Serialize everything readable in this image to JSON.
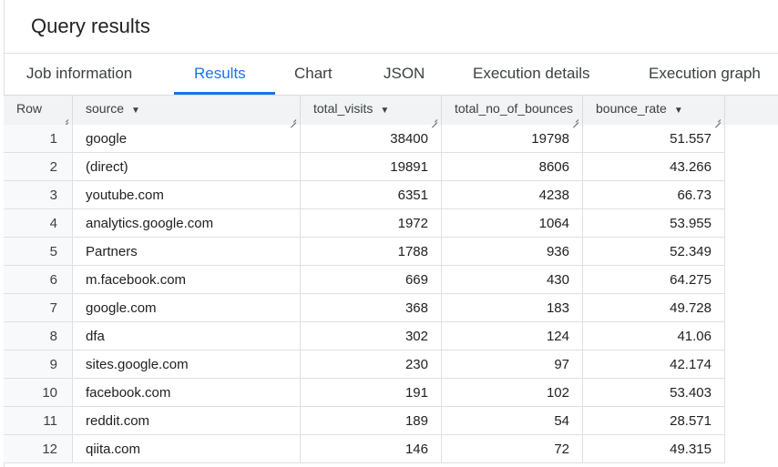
{
  "header": {
    "title": "Query results"
  },
  "tabs": [
    {
      "label": "Job information"
    },
    {
      "label": "Results"
    },
    {
      "label": "Chart"
    },
    {
      "label": "JSON"
    },
    {
      "label": "Execution details"
    },
    {
      "label": "Execution graph"
    }
  ],
  "active_tab": "Results",
  "table": {
    "columns": [
      {
        "label": "Row"
      },
      {
        "label": "source"
      },
      {
        "label": "total_visits"
      },
      {
        "label": "total_no_of_bounces"
      },
      {
        "label": "bounce_rate"
      }
    ],
    "rows": [
      {
        "row": "1",
        "source": "google",
        "total_visits": "38400",
        "total_no_of_bounces": "19798",
        "bounce_rate": "51.557"
      },
      {
        "row": "2",
        "source": "(direct)",
        "total_visits": "19891",
        "total_no_of_bounces": "8606",
        "bounce_rate": "43.266"
      },
      {
        "row": "3",
        "source": "youtube.com",
        "total_visits": "6351",
        "total_no_of_bounces": "4238",
        "bounce_rate": "66.73"
      },
      {
        "row": "4",
        "source": "analytics.google.com",
        "total_visits": "1972",
        "total_no_of_bounces": "1064",
        "bounce_rate": "53.955"
      },
      {
        "row": "5",
        "source": "Partners",
        "total_visits": "1788",
        "total_no_of_bounces": "936",
        "bounce_rate": "52.349"
      },
      {
        "row": "6",
        "source": "m.facebook.com",
        "total_visits": "669",
        "total_no_of_bounces": "430",
        "bounce_rate": "64.275"
      },
      {
        "row": "7",
        "source": "google.com",
        "total_visits": "368",
        "total_no_of_bounces": "183",
        "bounce_rate": "49.728"
      },
      {
        "row": "8",
        "source": "dfa",
        "total_visits": "302",
        "total_no_of_bounces": "124",
        "bounce_rate": "41.06"
      },
      {
        "row": "9",
        "source": "sites.google.com",
        "total_visits": "230",
        "total_no_of_bounces": "97",
        "bounce_rate": "42.174"
      },
      {
        "row": "10",
        "source": "facebook.com",
        "total_visits": "191",
        "total_no_of_bounces": "102",
        "bounce_rate": "53.403"
      },
      {
        "row": "11",
        "source": "reddit.com",
        "total_visits": "189",
        "total_no_of_bounces": "54",
        "bounce_rate": "28.571"
      },
      {
        "row": "12",
        "source": "qiita.com",
        "total_visits": "146",
        "total_no_of_bounces": "72",
        "bounce_rate": "49.315"
      }
    ]
  },
  "colors": {
    "accent": "#1a73e8",
    "header_bg": "#f1f3f4",
    "rownum_bg": "#f8f9fa",
    "border": "#e0e0e0"
  },
  "icons": {
    "sort": "arrow-drop-down-icon",
    "resize": "resize-handle-icon"
  }
}
